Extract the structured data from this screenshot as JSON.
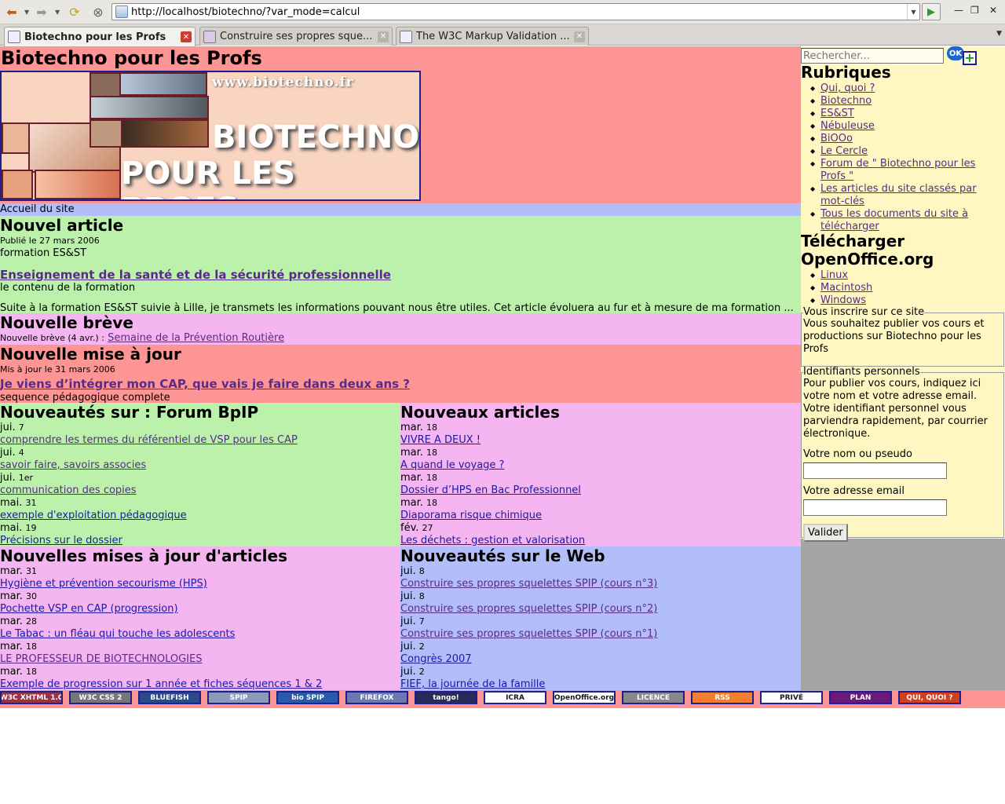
{
  "browser": {
    "url": "http://localhost/biotechno/?var_mode=calcul",
    "tabs": [
      {
        "label": "Biotechno pour les Profs",
        "active": true
      },
      {
        "label": "Construire ses propres sque...",
        "active": false
      },
      {
        "label": "The W3C Markup Validation ...",
        "active": false
      }
    ]
  },
  "site": {
    "title": "Biotechno pour les Profs",
    "banner_url": "www.biotechno.fr",
    "banner_line1": "BIOTECHNO",
    "banner_line2": "POUR LES PROFS",
    "breadcrumb": "Accueil du site"
  },
  "new_article": {
    "heading": "Nouvel article",
    "published": "Publié le 27 mars 2006",
    "rubric": "formation ES&ST",
    "title": "Enseignement de la santé et de la sécurité professionnelle",
    "subtitle": "le contenu de la formation",
    "intro": "Suite à la formation ES&ST suivie à Lille, je transmets les informations pouvant nous être utiles. Cet article évoluera au fur et à mesure de ma formation ..."
  },
  "new_breve": {
    "heading": "Nouvelle brève",
    "prefix": "Nouvelle brève (4 avr.) :",
    "link": "Semaine de la Prévention Routière"
  },
  "new_update": {
    "heading": "Nouvelle mise à jour",
    "date": "Mis à jour le 31 mars 2006",
    "title": "Je viens d’intégrer mon CAP, que vais je faire dans deux ans ?",
    "subtitle": "sequence pédagogique complete"
  },
  "forum": {
    "heading": "Nouveautés sur : Forum BpIP",
    "items": [
      {
        "day": "jui.",
        "num": "7",
        "title": "comprendre les termes du référentiel de VSP pour les CAP",
        "visited": true
      },
      {
        "day": "jui.",
        "num": "4",
        "title": "savoir faire, savoirs associes",
        "visited": true
      },
      {
        "day": "jui.",
        "num": "1er",
        "title": "communication des copies",
        "visited": true
      },
      {
        "day": "mai.",
        "num": "31",
        "title": "exemple d'exploitation pédagogique",
        "visited": false
      },
      {
        "day": "mai.",
        "num": "19",
        "title": "Précisions sur le dossier",
        "visited": false
      }
    ]
  },
  "new_articles": {
    "heading": "Nouveaux articles",
    "items": [
      {
        "day": "mar.",
        "num": "18",
        "title": "VIVRE A DEUX !",
        "visited": false
      },
      {
        "day": "mar.",
        "num": "18",
        "title": "A quand le voyage ?",
        "visited": false
      },
      {
        "day": "mar.",
        "num": "18",
        "title": "Dossier d’HPS en Bac Professionnel",
        "visited": false
      },
      {
        "day": "mar.",
        "num": "18",
        "title": "Diaporama risque chimique",
        "visited": false
      },
      {
        "day": "fév.",
        "num": "27",
        "title": "Les déchets : gestion et valorisation",
        "visited": false
      }
    ]
  },
  "article_updates": {
    "heading": "Nouvelles mises à jour d'articles",
    "items": [
      {
        "day": "mar.",
        "num": "31",
        "title": "Hygiène et prévention secourisme (HPS)",
        "visited": false
      },
      {
        "day": "mar.",
        "num": "30",
        "title": "Pochette VSP en CAP (progression)",
        "visited": false
      },
      {
        "day": "mar.",
        "num": "28",
        "title": "Le Tabac : un fléau qui touche les adolescents",
        "visited": false
      },
      {
        "day": "mar.",
        "num": "18",
        "title": "LE PROFESSEUR DE BIOTECHNOLOGIES",
        "visited": true
      },
      {
        "day": "mar.",
        "num": "18",
        "title": "Exemple de progression sur 1 année et fiches séquences 1 & 2",
        "visited": false
      }
    ]
  },
  "web_news": {
    "heading": "Nouveautés sur le Web",
    "items": [
      {
        "day": "jui.",
        "num": "8",
        "title": "Construire ses propres squelettes SPIP (cours n°3)",
        "visited": true
      },
      {
        "day": "jui.",
        "num": "8",
        "title": "Construire ses propres squelettes SPIP (cours n°2)",
        "visited": true
      },
      {
        "day": "jui.",
        "num": "7",
        "title": "Construire ses propres squelettes SPIP (cours n°1)",
        "visited": true
      },
      {
        "day": "jui.",
        "num": "2",
        "title": "Congrès 2007",
        "visited": false
      },
      {
        "day": "jui.",
        "num": "2",
        "title": "FIEF, la journée de la famille",
        "visited": false
      }
    ]
  },
  "sidebar": {
    "search_placeholder": "Rechercher...",
    "ok_label": "OK",
    "rubriques_heading": "Rubriques",
    "rubriques": [
      "Qui, quoi ?",
      "Biotechno",
      "ES&ST",
      "Nébuleuse",
      "BiOOo",
      "Le Cercle",
      "Forum de \" Biotechno pour les Profs \"",
      "Les articles du site classés par mot-clés",
      "Tous les documents du site à télécharger"
    ],
    "download_heading": "Télécharger OpenOffice.org",
    "download": [
      "Linux",
      "Macintosh",
      "Windows"
    ],
    "subscribe_legend": "Vous inscrire sur ce site",
    "subscribe_text": "Vous souhaitez publier vos cours et productions sur Biotechno pour les Profs",
    "ids_legend": "Identifiants personnels",
    "ids_text": "Pour publier vos cours, indiquez ici votre nom et votre adresse email. Votre identifiant personnel vous parviendra rapidement, par courrier électronique.",
    "name_label": "Votre nom ou pseudo",
    "email_label": "Votre adresse email",
    "submit_label": "Valider"
  },
  "footer_badges": [
    {
      "label": "W3C XHTML 1.0",
      "color": "#993344"
    },
    {
      "label": "W3C CSS 2",
      "color": "#777777"
    },
    {
      "label": "BLUEFISH",
      "color": "#2b4a8a"
    },
    {
      "label": "SPIP",
      "color": "#8a9ab8"
    },
    {
      "label": "bio SPIP",
      "color": "#2a5aa8"
    },
    {
      "label": "FIREFOX",
      "color": "#6a7ab0"
    },
    {
      "label": "tango!",
      "color": "#2a2a5a"
    },
    {
      "label": "ICRA",
      "color": "#ffffff"
    },
    {
      "label": "OpenOffice.org",
      "color": "#ffffff"
    },
    {
      "label": "LICENCE",
      "color": "#888888"
    },
    {
      "label": "RSS",
      "color": "#f08030"
    },
    {
      "label": "PRIVÉ",
      "color": "#ffffff"
    },
    {
      "label": "PLAN",
      "color": "#6a1a7a"
    },
    {
      "label": "QUI, QUOI ?",
      "color": "#d04020"
    }
  ]
}
